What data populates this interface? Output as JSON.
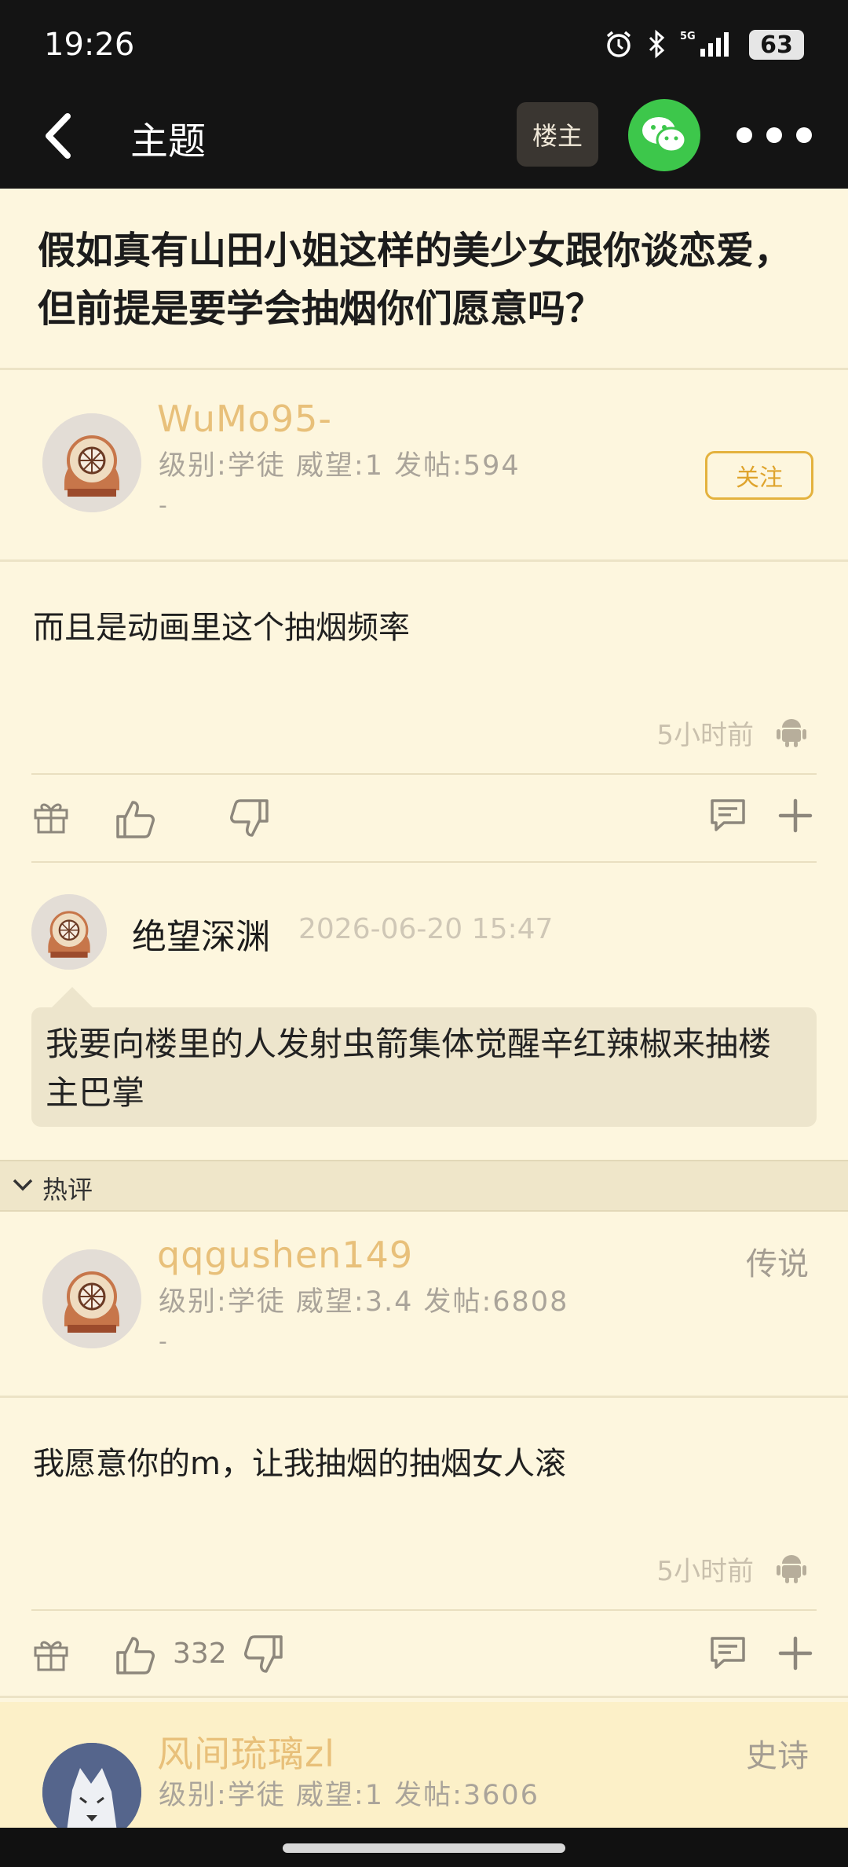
{
  "status_bar": {
    "time": "19:26",
    "battery": "63"
  },
  "nav": {
    "title": "主题",
    "louzhu_label": "楼主"
  },
  "thread": {
    "title": "假如真有山田小姐这样的美少女跟你谈恋爱，但前提是要学会抽烟你们愿意吗？"
  },
  "op": {
    "username": "WuMo95-",
    "info": "级别:学徒 威望:1 发帖:594",
    "dash": "-",
    "follow_label": "关注",
    "content": "而且是动画里这个抽烟频率",
    "time": "5小时前"
  },
  "reply": {
    "username": "绝望深渊",
    "date": "2026-06-20 15:47",
    "text": "我要向楼里的人发射虫箭集体觉醒辛红辣椒来抽楼主巴掌"
  },
  "hot_section": {
    "label": "热评"
  },
  "hot1": {
    "username": "qqgushen149",
    "info": "级别:学徒 威望:3.4 发帖:6808",
    "dash": "-",
    "rank": "传说",
    "content": "我愿意你的m，让我抽烟的抽烟女人滚",
    "time": "5小时前",
    "likes": "332"
  },
  "hot2": {
    "username": "风间琉璃zl",
    "info": "级别:学徒 威望:1 发帖:3606",
    "rank": "史诗"
  },
  "colors": {
    "accent": "#e8c07a",
    "follow": "#dfa42d",
    "background": "#fdf6de",
    "topbar": "#141414",
    "wechat": "#3dc74b"
  }
}
